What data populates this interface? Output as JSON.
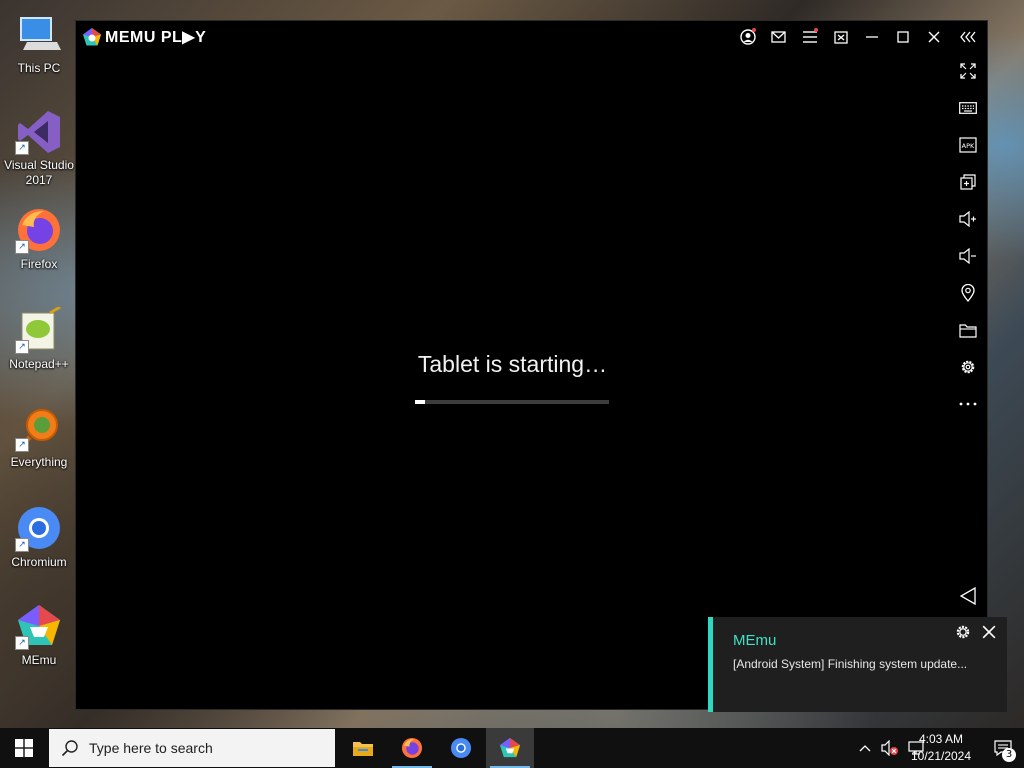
{
  "desktop": {
    "icons": [
      {
        "label": "This PC",
        "icon": "computer-icon"
      },
      {
        "label": "Visual Studio\n2017",
        "icon": "visual-studio-icon"
      },
      {
        "label": "Firefox",
        "icon": "firefox-icon"
      },
      {
        "label": "Notepad++",
        "icon": "notepad-plus-plus-icon"
      },
      {
        "label": "Everything",
        "icon": "everything-search-icon"
      },
      {
        "label": "Chromium",
        "icon": "chromium-icon"
      },
      {
        "label": "MEmu",
        "icon": "memu-icon"
      }
    ]
  },
  "emulator": {
    "logo_text": "MEMU PL▶Y",
    "title_buttons": [
      "account-icon",
      "mail-icon",
      "menu-icon",
      "screen-record-icon",
      "minimize-icon",
      "maximize-icon",
      "close-icon",
      "collapse-sidebar-icon"
    ],
    "sidebar_buttons": [
      "fullscreen-icon",
      "keyboard-icon",
      "apk-icon",
      "multi-instance-icon",
      "volume-up-icon",
      "volume-down-icon",
      "location-icon",
      "folder-icon",
      "settings-icon",
      "more-icon",
      "back-icon"
    ],
    "status_text": "Tablet is starting…",
    "progress": 0.05
  },
  "notification": {
    "app_name": "MEmu",
    "message": "[Android System] Finishing system update..."
  },
  "taskbar": {
    "search_placeholder": "Type here to search",
    "pinned_apps": [
      "file-explorer-icon",
      "firefox-icon",
      "chromium-icon",
      "memu-icon"
    ],
    "time": "4:03 AM",
    "date": "10/21/2024",
    "notification_count": "3",
    "accent_color": "#76b9ed"
  },
  "colors": {
    "toast_accent": "#2fd8c0",
    "toast_title": "#3fe2c6"
  }
}
